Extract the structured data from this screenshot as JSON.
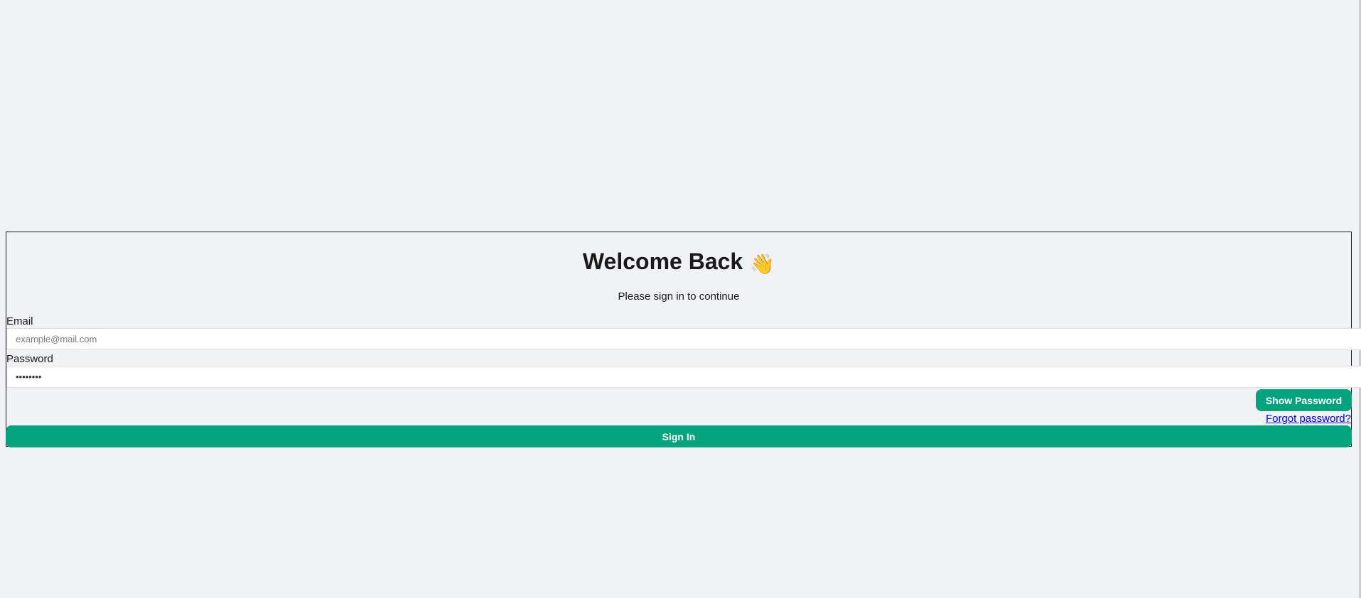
{
  "login": {
    "title": "Welcome Back",
    "title_emoji": "👋",
    "subtitle": "Please sign in to continue",
    "email": {
      "label": "Email",
      "placeholder": "example@mail.com",
      "value": ""
    },
    "password": {
      "label": "Password",
      "value": "••••••••"
    },
    "show_password_label": "Show Password",
    "forgot_password_label": "Forgot password?",
    "sign_in_label": "Sign In"
  },
  "colors": {
    "background": "#f0f2f5",
    "accent": "#03a37e",
    "link": "#0000ee",
    "text": "#1a1a1a"
  }
}
